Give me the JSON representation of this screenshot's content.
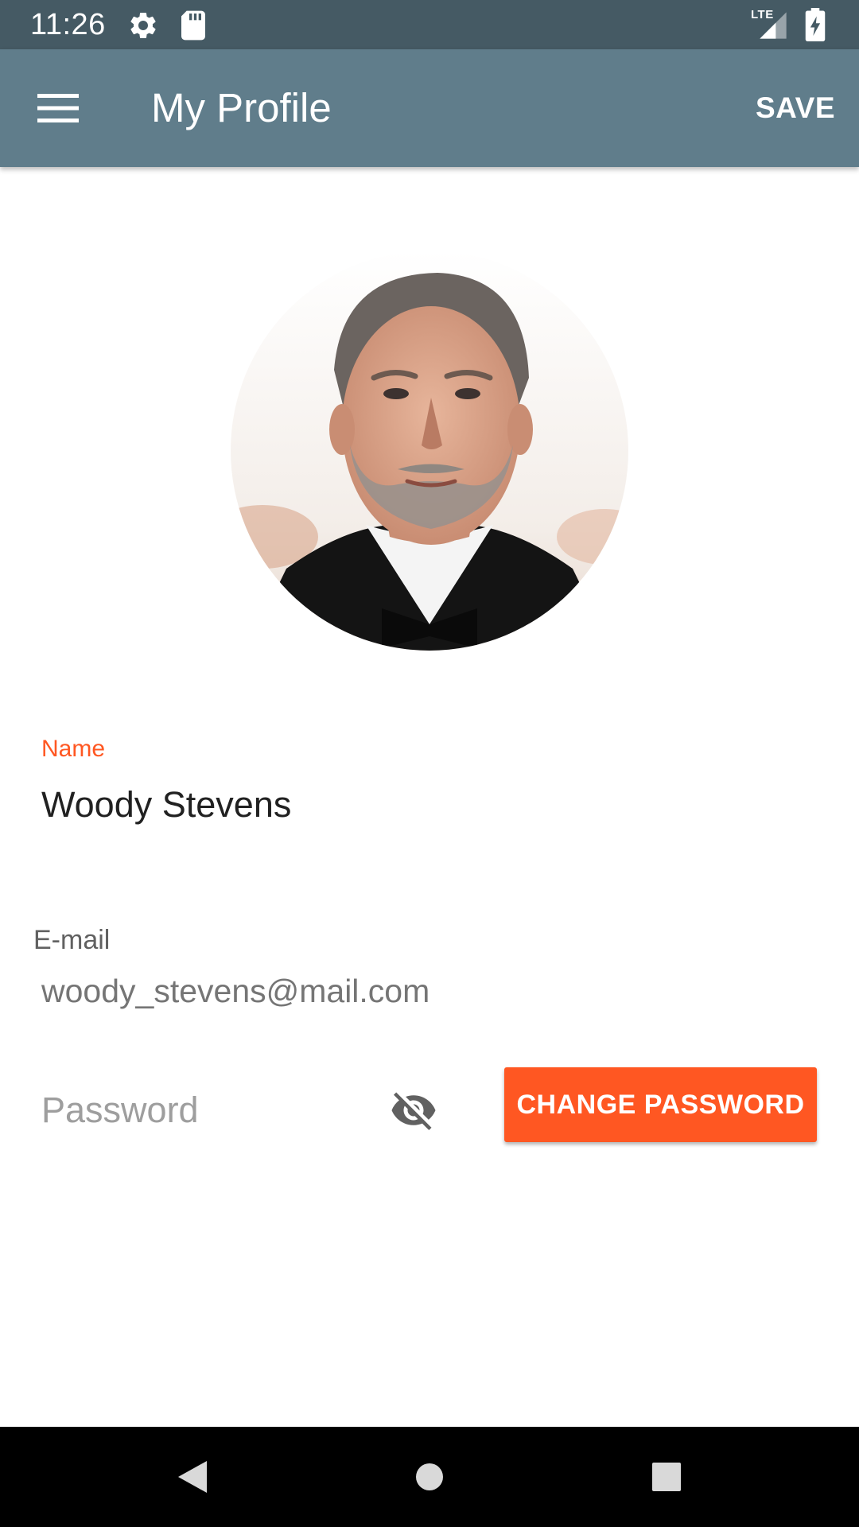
{
  "status_bar": {
    "time": "11:26",
    "network_label": "LTE",
    "icons": [
      "settings-gear-icon",
      "sd-card-icon",
      "signal-icon",
      "battery-charging-icon"
    ]
  },
  "app_bar": {
    "menu_icon": "hamburger-menu-icon",
    "title": "My Profile",
    "save_label": "SAVE",
    "background_color": "#607d8b"
  },
  "profile": {
    "avatar_icon": "profile-photo"
  },
  "form": {
    "name_label": "Name",
    "name_value": "Woody Stevens",
    "email_label": "E-mail",
    "email_value": "woody_stevens@mail.com",
    "password_placeholder": "Password",
    "visibility_icon": "visibility-off-icon",
    "change_password_label": "CHANGE PASSWORD",
    "accent_color": "#ff5722"
  },
  "nav_bar": {
    "icons": [
      "back-icon",
      "home-icon",
      "recents-icon"
    ]
  }
}
